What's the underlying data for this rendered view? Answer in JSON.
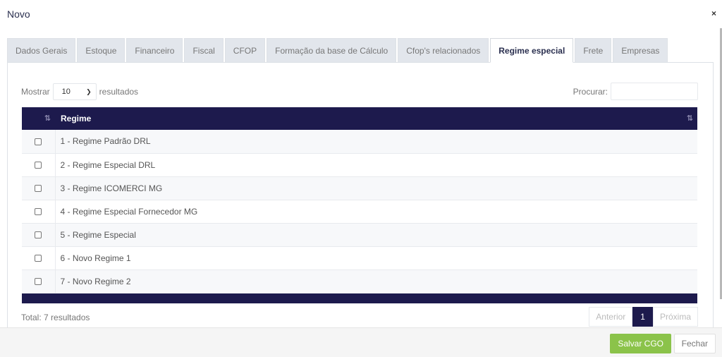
{
  "modal": {
    "title": "Novo",
    "close_glyph": "×"
  },
  "tabs": [
    {
      "label": "Dados Gerais",
      "active": false
    },
    {
      "label": "Estoque",
      "active": false
    },
    {
      "label": "Financeiro",
      "active": false
    },
    {
      "label": "Fiscal",
      "active": false
    },
    {
      "label": "CFOP",
      "active": false
    },
    {
      "label": "Formação da base de Cálculo",
      "active": false
    },
    {
      "label": "Cfop's relacionados",
      "active": false
    },
    {
      "label": "Regime especial",
      "active": true
    },
    {
      "label": "Frete",
      "active": false
    },
    {
      "label": "Empresas",
      "active": false
    }
  ],
  "length_menu": {
    "prefix": "Mostrar",
    "value": "10",
    "suffix": "resultados"
  },
  "search": {
    "label": "Procurar:",
    "value": ""
  },
  "table": {
    "header": {
      "regime": "Regime"
    },
    "rows": [
      {
        "regime": "1 - Regime Padrão DRL",
        "checked": false
      },
      {
        "regime": "2 - Regime Especial DRL",
        "checked": false
      },
      {
        "regime": "3 - Regime ICOMERCI MG",
        "checked": false
      },
      {
        "regime": "4 - Regime Especial Fornecedor MG",
        "checked": false
      },
      {
        "regime": "5 - Regime Especial",
        "checked": false
      },
      {
        "regime": "6 - Novo Regime 1",
        "checked": false
      },
      {
        "regime": "7 - Novo Regime 2",
        "checked": false
      }
    ]
  },
  "info": "Total: 7 resultados",
  "pagination": {
    "previous": "Anterior",
    "current": "1",
    "next": "Próxima"
  },
  "footer": {
    "save": "Salvar CGO",
    "close": "Fechar"
  },
  "colors": {
    "primary": "#1d1a4d",
    "success": "#8bc34a",
    "tab_bg": "#e2e6ec"
  }
}
